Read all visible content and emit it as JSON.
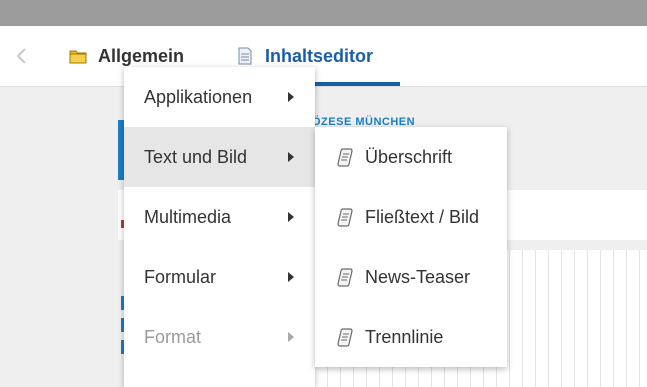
{
  "tabs": {
    "general": {
      "label": "Allgemein",
      "icon": "folder-icon"
    },
    "editor": {
      "label": "Inhaltseditor",
      "icon": "document-icon"
    }
  },
  "background": {
    "diocese_label": "ÖZESE MÜNCHEN"
  },
  "main_menu": {
    "items": [
      {
        "label": "Applikationen",
        "has_submenu": true,
        "state": "normal"
      },
      {
        "label": "Text und Bild",
        "has_submenu": true,
        "state": "active"
      },
      {
        "label": "Multimedia",
        "has_submenu": true,
        "state": "normal"
      },
      {
        "label": "Formular",
        "has_submenu": true,
        "state": "normal"
      },
      {
        "label": "Format",
        "has_submenu": true,
        "state": "disabled"
      }
    ]
  },
  "sub_menu": {
    "parent": "Text und Bild",
    "items": [
      {
        "label": "Überschrift",
        "icon": "scroll-icon"
      },
      {
        "label": "Fließtext / Bild",
        "icon": "scroll-icon"
      },
      {
        "label": "News-Teaser",
        "icon": "scroll-icon"
      },
      {
        "label": "Trennlinie",
        "icon": "scroll-icon"
      }
    ]
  },
  "colors": {
    "accent": "#1a5ea8",
    "topbar": "#9b9b9b",
    "active_item": "#e6e6e6",
    "disabled_text": "#9a9a9a"
  }
}
